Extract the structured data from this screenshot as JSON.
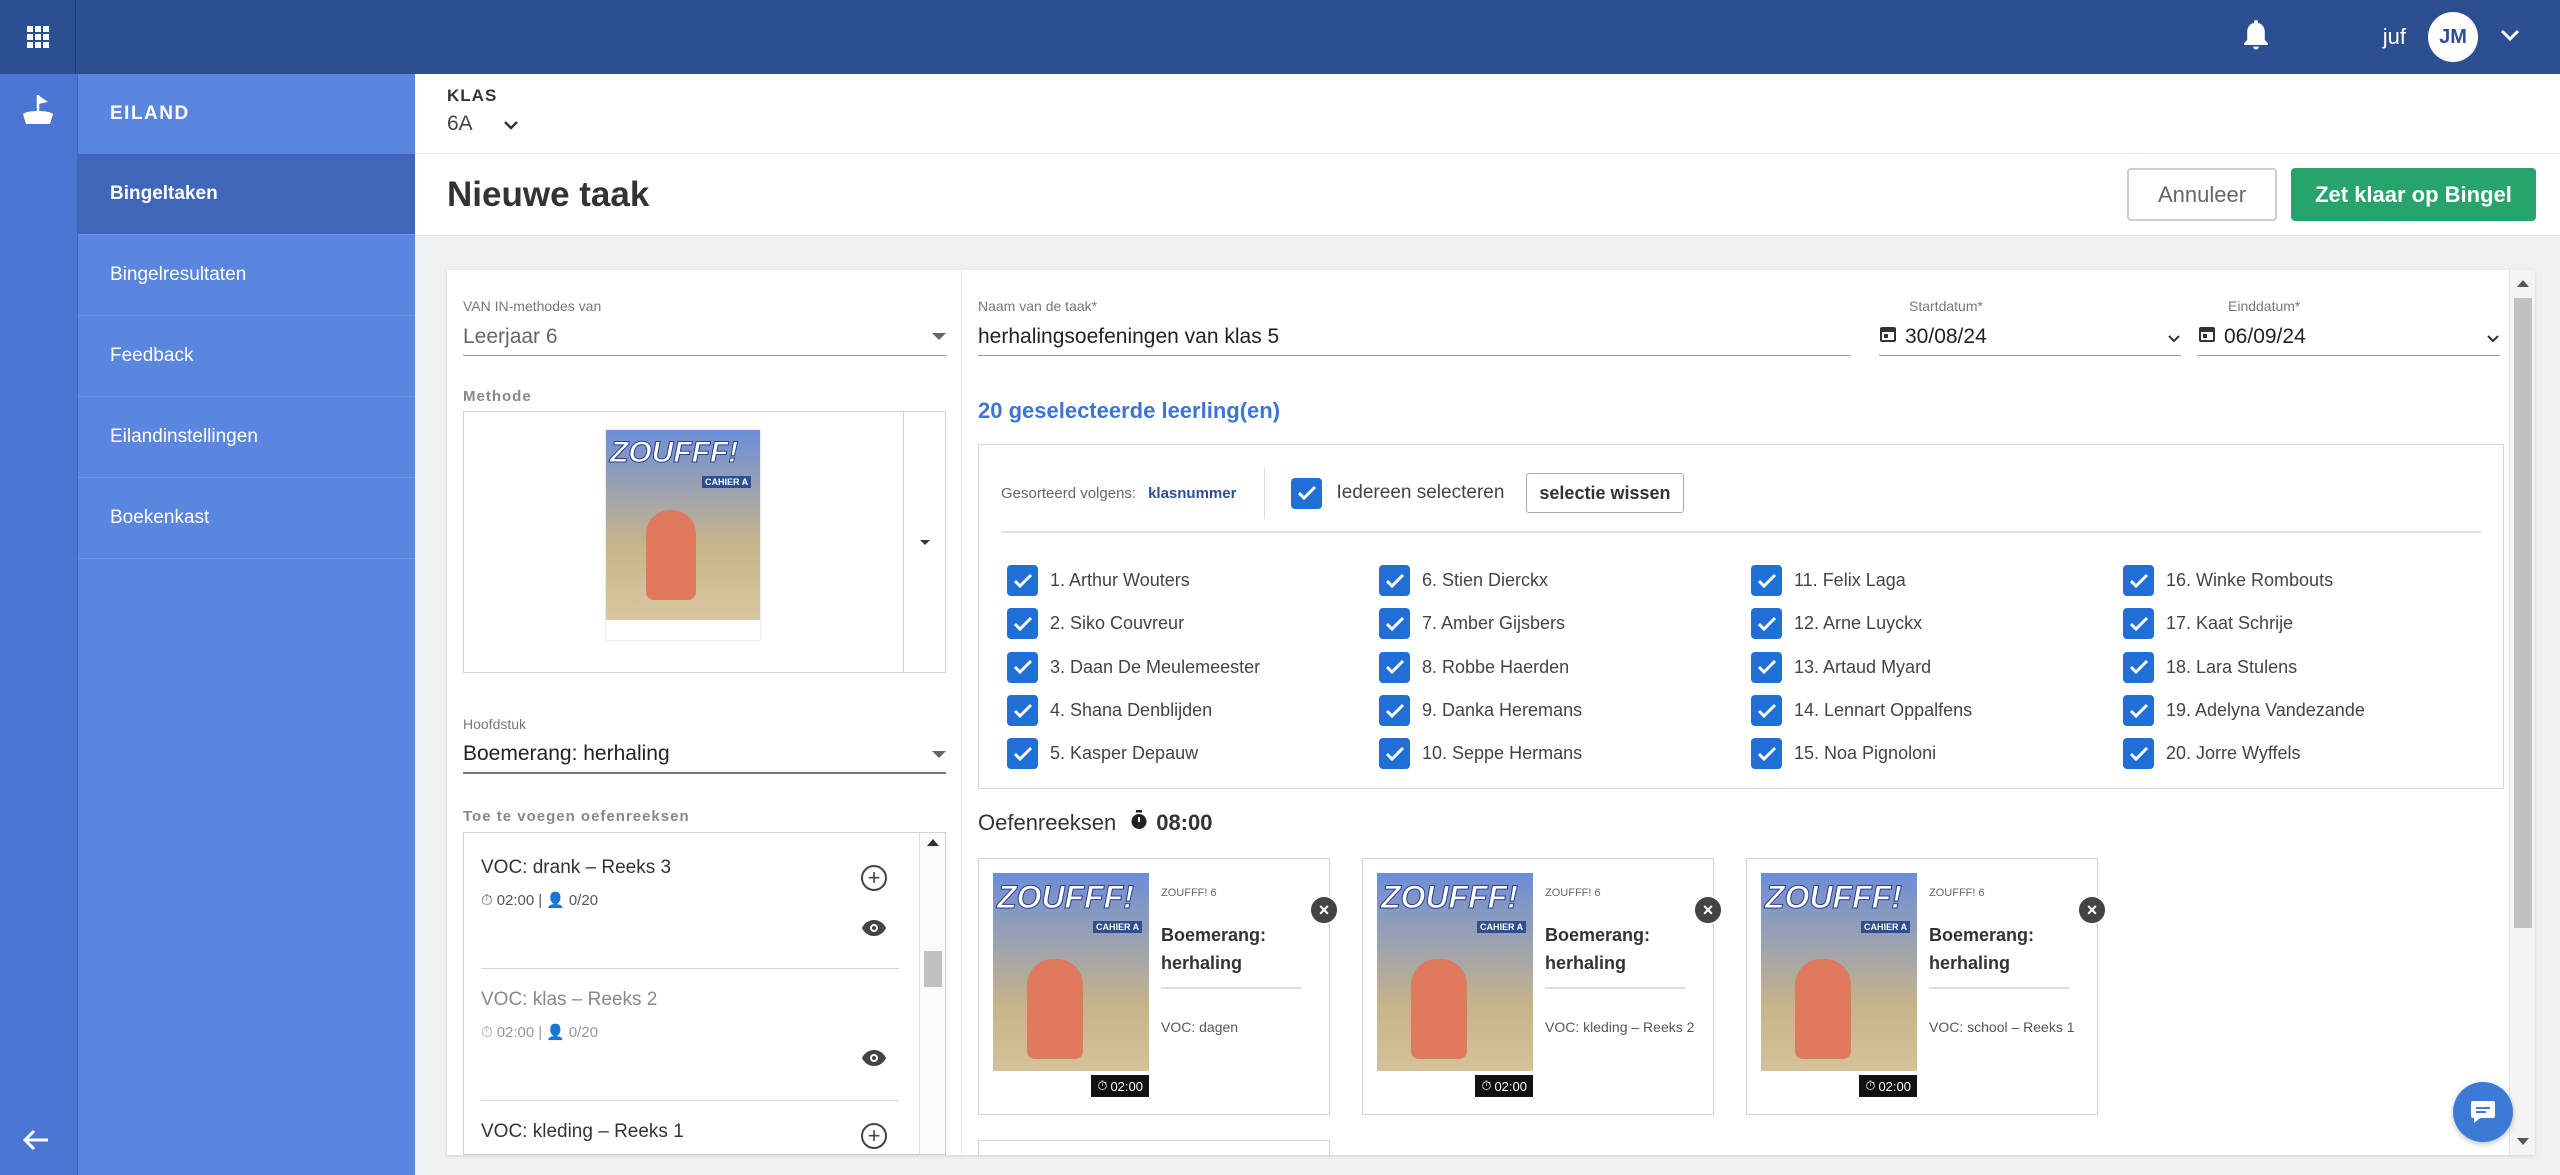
{
  "header": {
    "user_name": "juf",
    "avatar_initials": "JM"
  },
  "sidebar": {
    "title": "EILAND",
    "items": [
      {
        "label": "Bingeltaken",
        "active": true
      },
      {
        "label": "Bingelresultaten"
      },
      {
        "label": "Feedback"
      },
      {
        "label": "Eilandinstellingen"
      },
      {
        "label": "Boekenkast"
      }
    ]
  },
  "klas": {
    "label": "KLAS",
    "value": "6A"
  },
  "page": {
    "title": "Nieuwe taak",
    "cancel_label": "Annuleer",
    "submit_label": "Zet klaar op Bingel"
  },
  "form": {
    "methodes_label": "VAN IN-methodes van",
    "methodes_value": "Leerjaar 6",
    "methode_label": "Methode",
    "hoofdstuk_label": "Hoofdstuk",
    "hoofdstuk_value": "Boemerang: herhaling",
    "reeksen_label": "Toe te voegen oefenreeksen",
    "naam_label": "Naam van de taak*",
    "naam_value": "herhalingsoefeningen van klas 5",
    "start_label": "Startdatum*",
    "start_value": "30/08/24",
    "eind_label": "Einddatum*",
    "eind_value": "06/09/24"
  },
  "reeksen": [
    {
      "name": "VOC: drank – Reeks 3",
      "time": "02:00",
      "count": "0/20",
      "muted": false
    },
    {
      "name": "VOC: klas – Reeks 2",
      "time": "02:00",
      "count": "0/20",
      "muted": true
    },
    {
      "name": "VOC: kleding – Reeks 1",
      "time": "",
      "count": "",
      "muted": false
    }
  ],
  "selection": {
    "count_label": "20 geselecteerde leerling(en)",
    "sort_label": "Gesorteerd volgens:",
    "sort_value": "klasnummer",
    "select_all_label": "Iedereen selecteren",
    "clear_label": "selectie wissen"
  },
  "students": [
    "1. Arthur Wouters",
    "6. Stien Dierckx",
    "11. Felix Laga",
    "16. Winke Rombouts",
    "2. Siko Couvreur",
    "7. Amber Gijsbers",
    "12. Arne Luyckx",
    "17. Kaat Schrije",
    "3. Daan De Meulemeester",
    "8. Robbe Haerden",
    "13. Artaud Myard",
    "18. Lara Stulens",
    "4. Shana Denblijden",
    "9. Danka Heremans",
    "14. Lennart Oppalfens",
    "19. Adelyna Vandezande",
    "5. Kasper Depauw",
    "10. Seppe Hermans",
    "15. Noa Pignoloni",
    "20. Jorre Wyffels"
  ],
  "oefenreeksen": {
    "label": "Oefenreeksen",
    "total_time": "08:00",
    "cards": [
      {
        "publisher": "ZOUFFF! 6",
        "title": "Boemerang: herhaling",
        "subtitle": "VOC: dagen",
        "time": "02:00"
      },
      {
        "publisher": "ZOUFFF! 6",
        "title": "Boemerang: herhaling",
        "subtitle": "VOC: kleding – Reeks 2",
        "time": "02:00"
      },
      {
        "publisher": "ZOUFFF! 6",
        "title": "Boemerang: herhaling",
        "subtitle": "VOC: school – Reeks 1",
        "time": "02:00"
      }
    ]
  },
  "book_cover": {
    "title": "ZOUFFF!",
    "badge": "CAHIER A"
  },
  "colors": {
    "topbar": "#2c4f92",
    "sidebar": "#5a86e0",
    "sidebar_active": "#3f66b8",
    "primary": "#27a36c",
    "checkbox": "#1f6fd6",
    "link": "#3d74d6"
  }
}
